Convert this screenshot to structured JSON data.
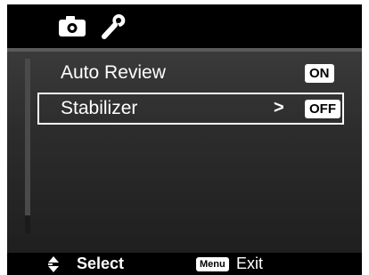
{
  "tabs": [
    {
      "icon": "camera-icon"
    },
    {
      "icon": "wrench-icon"
    }
  ],
  "menu": {
    "items": [
      {
        "label": "Auto Review",
        "value": "ON"
      },
      {
        "label": "Stabilizer",
        "value": "OFF",
        "arrow": ">"
      }
    ]
  },
  "footer": {
    "select_label": "Select",
    "menu_key": "Menu",
    "exit_label": "Exit"
  },
  "colors": {
    "background": "#000000",
    "panel": "#2e2e2e",
    "highlight_border": "#ffffff",
    "text": "#ffffff"
  }
}
